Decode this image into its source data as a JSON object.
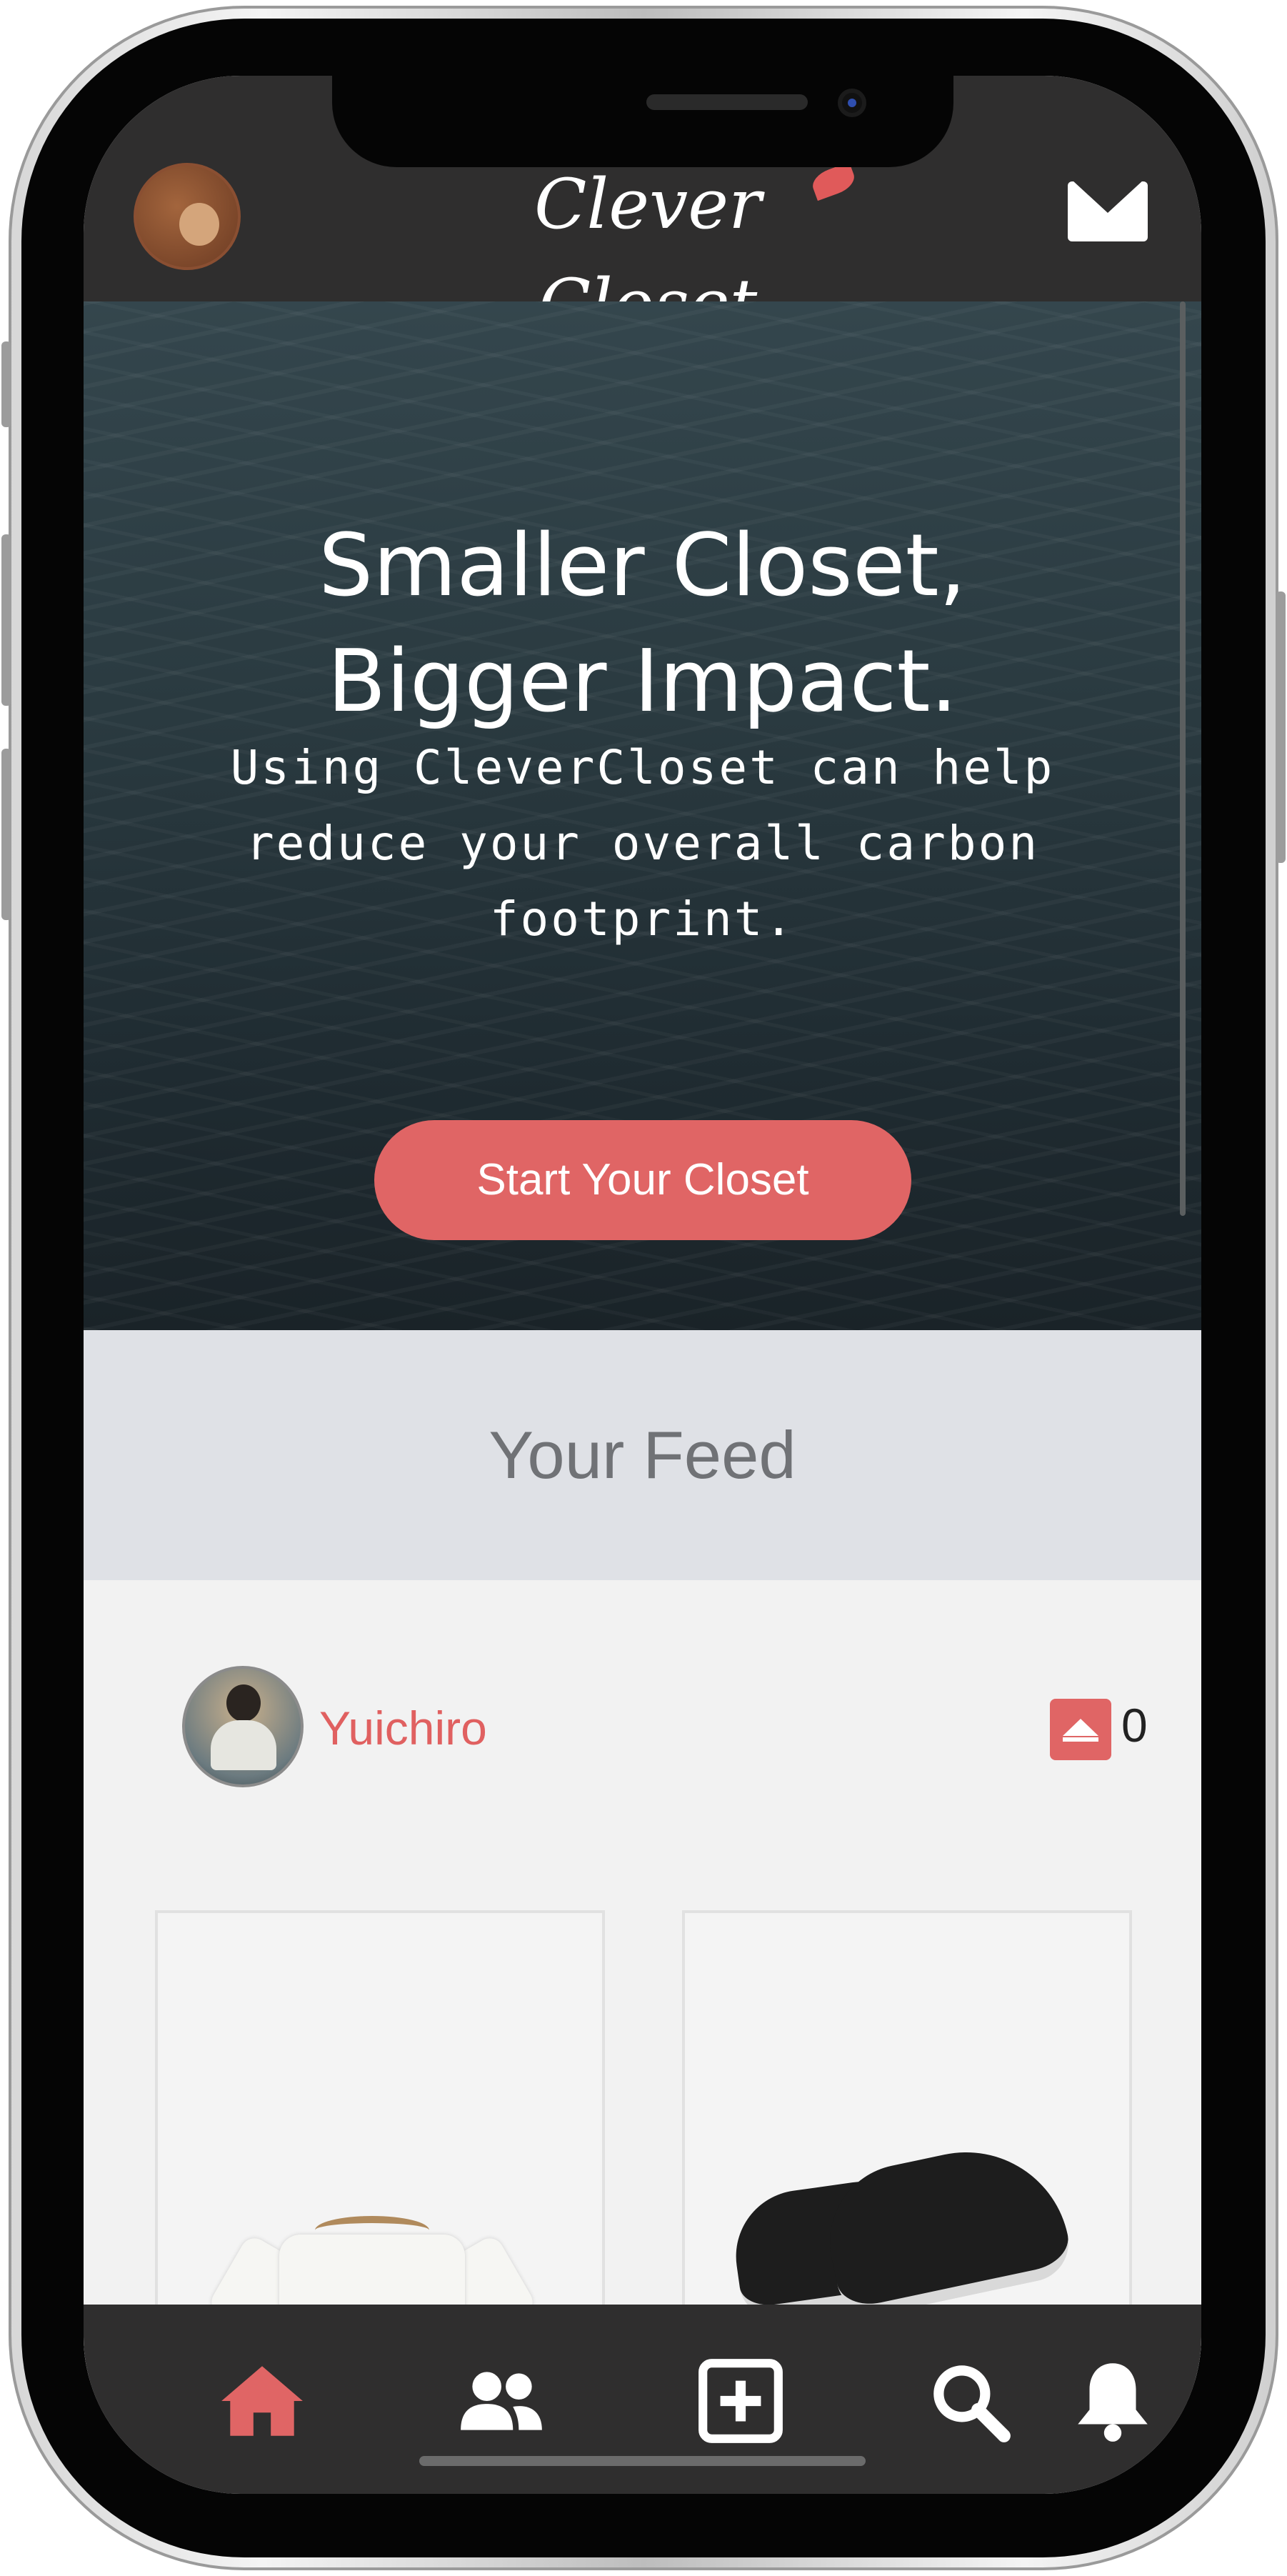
{
  "header": {
    "logo_text": "Clever Closet",
    "icons": [
      "avatar",
      "mail-icon"
    ]
  },
  "hero": {
    "title_line1": "Smaller Closet,",
    "title_line2": "Bigger Impact.",
    "subtitle": "Using CleverCloset can help reduce your overall carbon footprint.",
    "cta_label": "Start Your Closet"
  },
  "feed": {
    "title": "Your Feed",
    "post": {
      "username": "Yuichiro",
      "votes": "0",
      "items": [
        "t-shirt",
        "sneakers"
      ]
    }
  },
  "tabbar": {
    "items": [
      "home",
      "friends",
      "add",
      "search",
      "notifications"
    ],
    "active": "home"
  },
  "colors": {
    "accent": "#e06565",
    "header_bg": "#2f2e2e",
    "feed_header_bg": "#dfe1e6"
  }
}
